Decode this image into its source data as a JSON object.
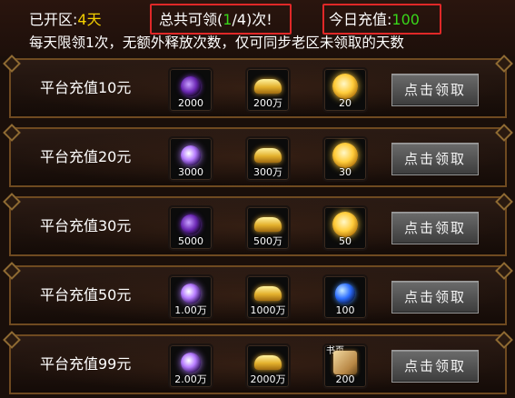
{
  "top": {
    "opened_label": "已开区:",
    "opened_value": "4天",
    "total_prefix": "总共可领(",
    "total_current": "1",
    "total_suffix": "/4)次!",
    "today_label": "今日充值:",
    "today_value": "100",
    "hint": "每天限领1次，无额外释放次数，仅可同步老区未领取的天数"
  },
  "colors": {
    "highlight_green": "#39d61a",
    "highlight_yellow": "#f4d000",
    "callout_red": "#e02828",
    "frame_gold": "#6f4a20"
  },
  "rows": [
    {
      "label": "平台充值10元",
      "items": [
        {
          "icon": "purple-orb-icon",
          "qty": "2000"
        },
        {
          "icon": "gold-ingot-icon",
          "qty": "200万"
        },
        {
          "icon": "gold-coin-icon",
          "qty": "20"
        }
      ],
      "button": "点击领取"
    },
    {
      "label": "平台充值20元",
      "items": [
        {
          "icon": "purple-orb-icon",
          "qty": "3000"
        },
        {
          "icon": "gold-ingot-icon",
          "qty": "300万"
        },
        {
          "icon": "gold-coin-icon",
          "qty": "30"
        }
      ],
      "button": "点击领取"
    },
    {
      "label": "平台充值30元",
      "items": [
        {
          "icon": "purple-orb-icon",
          "qty": "5000"
        },
        {
          "icon": "gold-ingot-icon",
          "qty": "500万"
        },
        {
          "icon": "gold-coin-icon",
          "qty": "50"
        }
      ],
      "button": "点击领取"
    },
    {
      "label": "平台充值50元",
      "items": [
        {
          "icon": "purple-orb-icon",
          "qty": "1.00万"
        },
        {
          "icon": "gold-ingot-icon",
          "qty": "1000万"
        },
        {
          "icon": "blue-gem-icon",
          "qty": "100"
        }
      ],
      "button": "点击领取"
    },
    {
      "label": "平台充值99元",
      "items": [
        {
          "icon": "purple-orb-icon",
          "qty": "2.00万"
        },
        {
          "icon": "gold-ingot-icon",
          "qty": "2000万"
        },
        {
          "icon": "book-icon",
          "qty": "200",
          "tag": "书页"
        }
      ],
      "button": "点击领取"
    }
  ]
}
